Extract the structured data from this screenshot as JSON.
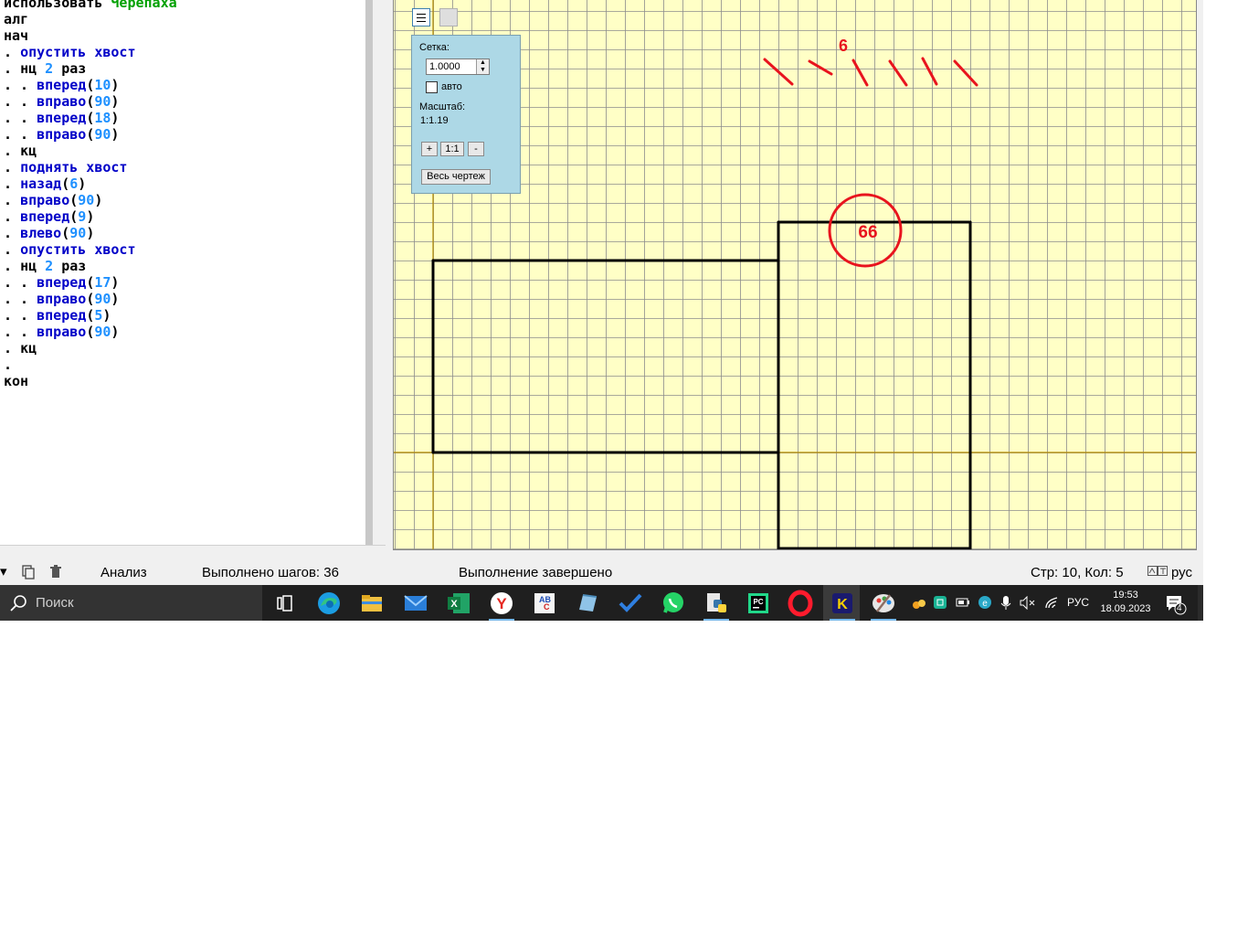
{
  "editor": {
    "lines": [
      [
        {
          "t": "использовать ",
          "c": "kw"
        },
        {
          "t": "Черепаха",
          "c": "lib"
        }
      ],
      [
        {
          "t": "алг",
          "c": "kw"
        }
      ],
      [
        {
          "t": "нач",
          "c": "kw"
        }
      ],
      [
        {
          "t": ". ",
          "c": "pun"
        },
        {
          "t": "опустить хвост",
          "c": "cmd"
        }
      ],
      [
        {
          "t": ". ",
          "c": "pun"
        },
        {
          "t": "нц ",
          "c": "kw"
        },
        {
          "t": "2",
          "c": "num"
        },
        {
          "t": " раз",
          "c": "kw"
        }
      ],
      [
        {
          "t": ". . ",
          "c": "pun"
        },
        {
          "t": "вперед",
          "c": "cmd"
        },
        {
          "t": "(",
          "c": "pun"
        },
        {
          "t": "10",
          "c": "num"
        },
        {
          "t": ")",
          "c": "pun"
        }
      ],
      [
        {
          "t": ". . ",
          "c": "pun"
        },
        {
          "t": "вправо",
          "c": "cmd"
        },
        {
          "t": "(",
          "c": "pun"
        },
        {
          "t": "90",
          "c": "num"
        },
        {
          "t": ")",
          "c": "pun"
        }
      ],
      [
        {
          "t": ". . ",
          "c": "pun"
        },
        {
          "t": "вперед",
          "c": "cmd"
        },
        {
          "t": "(",
          "c": "pun"
        },
        {
          "t": "18",
          "c": "num"
        },
        {
          "t": ")",
          "c": "pun"
        }
      ],
      [
        {
          "t": ". . ",
          "c": "pun"
        },
        {
          "t": "вправо",
          "c": "cmd"
        },
        {
          "t": "(",
          "c": "pun"
        },
        {
          "t": "90",
          "c": "num"
        },
        {
          "t": ")",
          "c": "pun"
        }
      ],
      [
        {
          "t": ". ",
          "c": "pun"
        },
        {
          "t": "кц",
          "c": "kw"
        }
      ],
      [
        {
          "t": ". ",
          "c": "pun"
        },
        {
          "t": "поднять хвост",
          "c": "cmd"
        }
      ],
      [
        {
          "t": ". ",
          "c": "pun"
        },
        {
          "t": "назад",
          "c": "cmd"
        },
        {
          "t": "(",
          "c": "pun"
        },
        {
          "t": "6",
          "c": "num"
        },
        {
          "t": ")",
          "c": "pun"
        }
      ],
      [
        {
          "t": ". ",
          "c": "pun"
        },
        {
          "t": "вправо",
          "c": "cmd"
        },
        {
          "t": "(",
          "c": "pun"
        },
        {
          "t": "90",
          "c": "num"
        },
        {
          "t": ")",
          "c": "pun"
        }
      ],
      [
        {
          "t": ". ",
          "c": "pun"
        },
        {
          "t": "вперед",
          "c": "cmd"
        },
        {
          "t": "(",
          "c": "pun"
        },
        {
          "t": "9",
          "c": "num"
        },
        {
          "t": ")",
          "c": "pun"
        }
      ],
      [
        {
          "t": ". ",
          "c": "pun"
        },
        {
          "t": "влево",
          "c": "cmd"
        },
        {
          "t": "(",
          "c": "pun"
        },
        {
          "t": "90",
          "c": "num"
        },
        {
          "t": ")",
          "c": "pun"
        }
      ],
      [
        {
          "t": ". ",
          "c": "pun"
        },
        {
          "t": "опустить хвост",
          "c": "cmd"
        }
      ],
      [
        {
          "t": ". ",
          "c": "pun"
        },
        {
          "t": "нц ",
          "c": "kw"
        },
        {
          "t": "2",
          "c": "num"
        },
        {
          "t": " раз",
          "c": "kw"
        }
      ],
      [
        {
          "t": ". . ",
          "c": "pun"
        },
        {
          "t": "вперед",
          "c": "cmd"
        },
        {
          "t": "(",
          "c": "pun"
        },
        {
          "t": "17",
          "c": "num"
        },
        {
          "t": ")",
          "c": "pun"
        }
      ],
      [
        {
          "t": ". . ",
          "c": "pun"
        },
        {
          "t": "вправо",
          "c": "cmd"
        },
        {
          "t": "(",
          "c": "pun"
        },
        {
          "t": "90",
          "c": "num"
        },
        {
          "t": ")",
          "c": "pun"
        }
      ],
      [
        {
          "t": ". . ",
          "c": "pun"
        },
        {
          "t": "вперед",
          "c": "cmd"
        },
        {
          "t": "(",
          "c": "pun"
        },
        {
          "t": "5",
          "c": "num"
        },
        {
          "t": ")",
          "c": "pun"
        }
      ],
      [
        {
          "t": ". . ",
          "c": "pun"
        },
        {
          "t": "вправо",
          "c": "cmd"
        },
        {
          "t": "(",
          "c": "pun"
        },
        {
          "t": "90",
          "c": "num"
        },
        {
          "t": ")",
          "c": "pun"
        }
      ],
      [
        {
          "t": ". ",
          "c": "pun"
        },
        {
          "t": "кц",
          "c": "kw"
        }
      ],
      [
        {
          "t": ".",
          "c": "pun"
        }
      ],
      [
        {
          "t": "кон",
          "c": "kw"
        }
      ]
    ]
  },
  "drawing": {
    "annotation_top": "6",
    "annotation_circle": "66",
    "colors": {
      "background": "#ffffc6",
      "grid": "#8c8c8c",
      "axis": "#b48c00",
      "line": "#000000",
      "annotation": "#e8141e"
    }
  },
  "grid_popup": {
    "grid_label": "Сетка:",
    "grid_value": "1.0000",
    "auto_label": "авто",
    "auto_checked": false,
    "scale_label": "Масштаб:",
    "scale_value": "1:1.19",
    "zoom_in": "+",
    "zoom_reset": "1:1",
    "zoom_out": "-",
    "whole_drawing": "Весь чертеж"
  },
  "status_bar": {
    "analysis": "Анализ",
    "steps": "Выполнено шагов: 36",
    "state": "Выполнение завершено",
    "cursor": "Стр: 10, Кол: 5",
    "keyboard": "рус"
  },
  "taskbar": {
    "search_placeholder": "Поиск",
    "apps": [
      "task-view",
      "edge",
      "file-explorer",
      "mail",
      "excel",
      "yandex-browser",
      "abc-net",
      "notepad",
      "todo",
      "whatsapp",
      "python",
      "pycharm",
      "opera",
      "kumir",
      "paint"
    ],
    "tray_language": "РУС",
    "time": "19:53",
    "date": "18.09.2023",
    "notification_count": "4"
  }
}
